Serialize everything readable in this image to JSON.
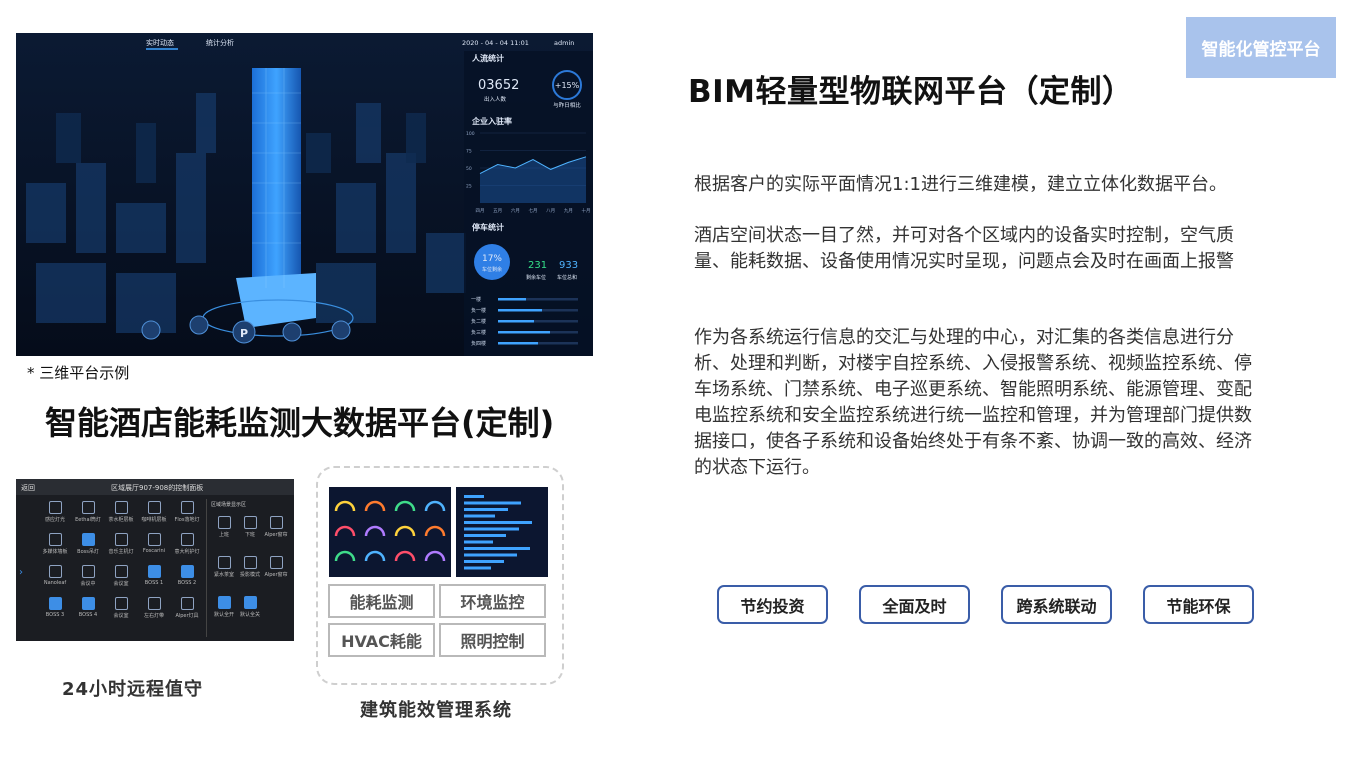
{
  "tag": "智能化管控平台",
  "main_title": "BIM轻量型物联网平台（定制）",
  "paragraphs": [
    "根据客户的实际平面情况1:1进行三维建模，建立立体化数据平台。",
    "酒店空间状态一目了然，并可对各个区域内的设备实时控制，空气质量、能耗数据、设备使用情况实时呈现，问题点会及时在画面上报警",
    "作为各系统运行信息的交汇与处理的中心，对汇集的各类信息进行分析、处理和判断，对楼宇自控系统、入侵报警系统、视频监控系统、停车场系统、门禁系统、电子巡更系统、智能照明系统、能源管理、变配电监控系统和安全监控系统进行统一监控和管理，并为管理部门提供数据接口，使各子系统和设备始终处于有条不紊、协调一致的高效、经济的状态下运行。"
  ],
  "features": [
    "节约投资",
    "全面及时",
    "跨系统联动",
    "节能环保"
  ],
  "dashboard": {
    "tabs": [
      "实时动态",
      "统计分析"
    ],
    "datetime": "2020 - 04 - 04   11:01",
    "user": "admin",
    "sections": [
      "人流统计",
      "企业入驻率",
      "停车统计"
    ],
    "people_count": "03652",
    "people_label": "出入人数",
    "change_pct": "+15%",
    "change_label": "与昨日相比",
    "months": [
      "四月",
      "五月",
      "六月",
      "七月",
      "八月",
      "九月",
      "十月"
    ],
    "y_ticks": [
      "100",
      "75",
      "50",
      "25"
    ],
    "occupancy_values": [
      42,
      55,
      50,
      62,
      48,
      58,
      66
    ],
    "parking_pct": "17%",
    "parking_pct_label": "车位剩余",
    "parking_left": "231",
    "parking_left_label": "剩余车位",
    "parking_total": "933",
    "parking_total_label": "车位总和",
    "floors": [
      "一楼",
      "负一楼",
      "负二楼",
      "负三楼",
      "负四楼"
    ],
    "floor_fill": [
      0.35,
      0.55,
      0.45,
      0.65,
      0.5
    ]
  },
  "caption": "* 三维平台示例",
  "big_title": "智能酒店能耗监测大数据平台(定制)",
  "panel": {
    "back": "返回",
    "title": "区域展厅907-908的控制面板",
    "side_title": "区域场景显示区",
    "cells": [
      "感应灯光",
      "Eethal筒灯",
      "茶水柜层板",
      "咖啡机层板",
      "Flos落地灯",
      "多媒体墙板",
      "Boss吊灯",
      "音乐主机灯",
      "Foscarini",
      "意大利护灯",
      "Nanoleaf",
      "会议中",
      "会议室",
      "BOSS 1",
      "BOSS 2",
      "BOSS 3",
      "BOSS 4",
      "会议室",
      "左右灯带",
      "Alper灯具"
    ],
    "side_items": [
      "上班",
      "下班",
      "Alper窗帘",
      "紧水茶室",
      "投影模式",
      "Alper窗帘",
      "默认全开",
      "默认全关"
    ]
  },
  "remote_label": "24小时远程值守",
  "energy_buttons": [
    "能耗监测",
    "环境监控",
    "HVAC耗能",
    "照明控制"
  ],
  "energy_label": "建筑能效管理系统"
}
